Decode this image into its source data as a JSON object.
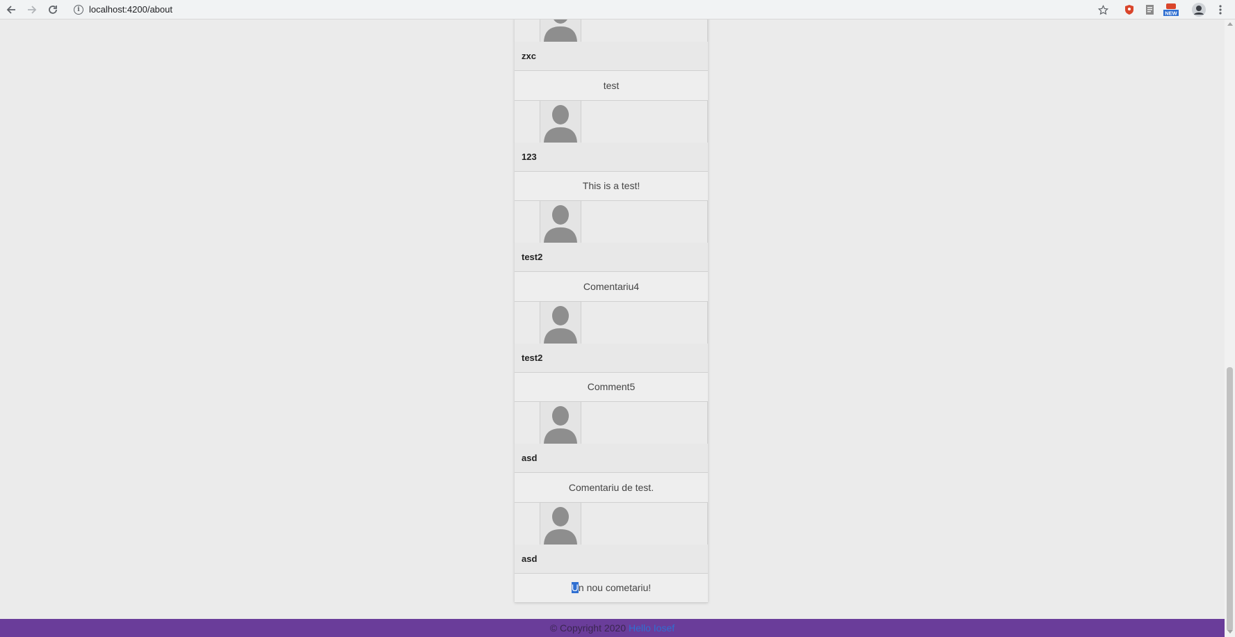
{
  "browser": {
    "url": "localhost:4200/about",
    "icons": [
      "back-arrow-icon",
      "forward-arrow-icon",
      "reload-icon",
      "info-icon",
      "star-icon",
      "shield-extension-icon",
      "document-extension-icon",
      "new-badge-extension-icon",
      "profile-avatar-icon",
      "menu-kebab-icon"
    ],
    "new_badge": "NEW"
  },
  "comments": [
    {
      "author": "zxc",
      "text": "test"
    },
    {
      "author": "123",
      "text": "This is a test!"
    },
    {
      "author": "test2",
      "text": "Comentariu4"
    },
    {
      "author": "test2",
      "text": "Comment5"
    },
    {
      "author": "asd",
      "text": "Comentariu de test."
    },
    {
      "author": "asd",
      "text_selected": "U",
      "text_rest": "n nou cometariu!"
    }
  ],
  "footer": {
    "copyright": "© Copyright 2020",
    "greeting": "Hello Iosef"
  },
  "colors": {
    "footer_bg": "#6a3d9a",
    "selection": "#2f6fd1",
    "link": "#2f6fd1"
  }
}
